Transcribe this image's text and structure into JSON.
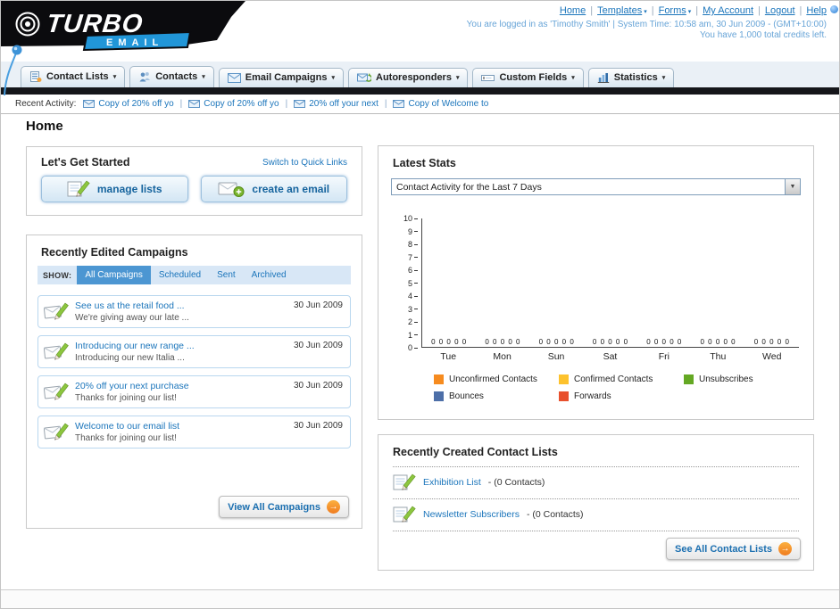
{
  "logo": {
    "primary": "TURBO",
    "secondary": "EMAIL"
  },
  "header": {
    "nav": [
      {
        "label": "Home",
        "caret": false
      },
      {
        "label": "Templates",
        "caret": true
      },
      {
        "label": "Forms",
        "caret": true
      },
      {
        "label": "My Account",
        "caret": false
      },
      {
        "label": "Logout",
        "caret": false
      },
      {
        "label": "Help",
        "caret": false
      }
    ],
    "login_line": "You are logged in as 'Timothy Smith' | System Time: 10:58 am, 30 Jun 2009 - (GMT+10:00)",
    "credits_line": "You have 1,000 total credits left."
  },
  "tabs": [
    {
      "label": "Contact Lists",
      "icon": "contact-lists-icon"
    },
    {
      "label": "Contacts",
      "icon": "contacts-icon"
    },
    {
      "label": "Email Campaigns",
      "icon": "email-campaigns-icon"
    },
    {
      "label": "Autoresponders",
      "icon": "autoresponders-icon"
    },
    {
      "label": "Custom Fields",
      "icon": "custom-fields-icon"
    },
    {
      "label": "Statistics",
      "icon": "statistics-icon"
    }
  ],
  "recent_activity": {
    "label": "Recent Activity:",
    "item_icon": "mail-icon",
    "items": [
      "Copy of 20% off yo",
      "Copy of 20% off yo",
      "20% off your next",
      "Copy of Welcome to"
    ]
  },
  "page": {
    "title": "Home"
  },
  "get_started": {
    "title": "Let's Get Started",
    "switch_link": "Switch to Quick Links",
    "buttons": [
      {
        "label": "manage lists",
        "icon": "pencil-list-icon"
      },
      {
        "label": "create an email",
        "icon": "mail-plus-icon"
      }
    ]
  },
  "campaigns": {
    "title": "Recently Edited Campaigns",
    "show_label": "SHOW:",
    "filters": [
      {
        "label": "All Campaigns",
        "selected": true
      },
      {
        "label": "Scheduled",
        "selected": false
      },
      {
        "label": "Sent",
        "selected": false
      },
      {
        "label": "Archived",
        "selected": false
      }
    ],
    "item_icon": "mail-pencil-icon",
    "items": [
      {
        "title": "See us at the retail food ...",
        "subtitle": "We're giving away our late ...",
        "date": "30 Jun 2009"
      },
      {
        "title": "Introducing our new range ...",
        "subtitle": "Introducing our new Italia ...",
        "date": "30 Jun 2009"
      },
      {
        "title": "20% off your next purchase",
        "subtitle": "Thanks for joining our list!",
        "date": "30 Jun 2009"
      },
      {
        "title": "Welcome to our email list",
        "subtitle": "Thanks for joining our list!",
        "date": "30 Jun 2009"
      }
    ],
    "view_all": {
      "label": "View All Campaigns",
      "icon": "arrow-right-icon"
    }
  },
  "stats": {
    "title": "Latest Stats",
    "dropdown_value": "Contact Activity for the Last 7 Days",
    "chart_data": {
      "type": "bar",
      "title": "Contact Activity for the Last 7 Days",
      "categories": [
        "Tue",
        "Mon",
        "Sun",
        "Sat",
        "Fri",
        "Thu",
        "Wed"
      ],
      "series": [
        {
          "name": "Unconfirmed Contacts",
          "color": "#f68b1f",
          "values": [
            0,
            0,
            0,
            0,
            0,
            0,
            0
          ]
        },
        {
          "name": "Confirmed Contacts",
          "color": "#fdc22d",
          "values": [
            0,
            0,
            0,
            0,
            0,
            0,
            0
          ]
        },
        {
          "name": "Unsubscribes",
          "color": "#64a823",
          "values": [
            0,
            0,
            0,
            0,
            0,
            0,
            0
          ]
        },
        {
          "name": "Bounces",
          "color": "#4d6fa8",
          "values": [
            0,
            0,
            0,
            0,
            0,
            0,
            0
          ]
        },
        {
          "name": "Forwards",
          "color": "#e8502d",
          "values": [
            0,
            0,
            0,
            0,
            0,
            0,
            0
          ]
        }
      ],
      "ylim": [
        0,
        10
      ],
      "grid": false,
      "legend_position": "bottom"
    }
  },
  "contact_lists": {
    "title": "Recently Created Contact Lists",
    "item_icon": "pencil-list-icon",
    "items": [
      {
        "name": "Exhibition List",
        "suffix": "- (0 Contacts)"
      },
      {
        "name": "Newsletter Subscribers",
        "suffix": "- (0 Contacts)"
      }
    ],
    "see_all": {
      "label": "See All Contact Lists",
      "icon": "arrow-right-icon"
    }
  },
  "colors": {
    "link_blue": "#1b75bb",
    "accent_orange": "#f7941d",
    "dark_bar": "#15161a",
    "logo_blue": "#2196d8"
  }
}
